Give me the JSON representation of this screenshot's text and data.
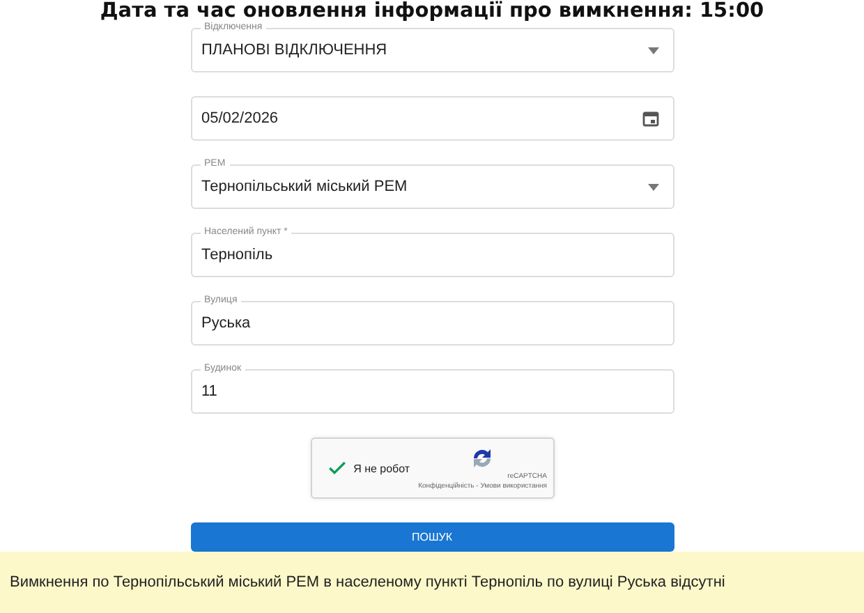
{
  "title": "Дата та час оновлення інформації про вимкнення: 15:00",
  "fields": [
    {
      "kind": "select",
      "label": "Відключення",
      "value": "ПЛАНОВІ ВІДКЛЮЧЕННЯ"
    },
    {
      "kind": "date",
      "value": "05/02/2026"
    },
    {
      "kind": "select",
      "label": "РЕМ",
      "value": "Тернопільський міський РЕМ"
    },
    {
      "kind": "text",
      "label": "Населений пункт *",
      "value": "Тернопіль"
    },
    {
      "kind": "text",
      "label": "Вулиця",
      "value": "Руська"
    },
    {
      "kind": "text",
      "label": "Будинок",
      "value": "11"
    }
  ],
  "captcha": {
    "checked": true,
    "label": "Я не робот",
    "brand": "reCAPTCHA",
    "links": "Конфіденційність - Умови використання"
  },
  "search_button": "ПОШУК",
  "result": "Вимкнення по Тернопільський міський РЕМ в населеному пункті Тернопіль по вулиці Руська відсутні"
}
